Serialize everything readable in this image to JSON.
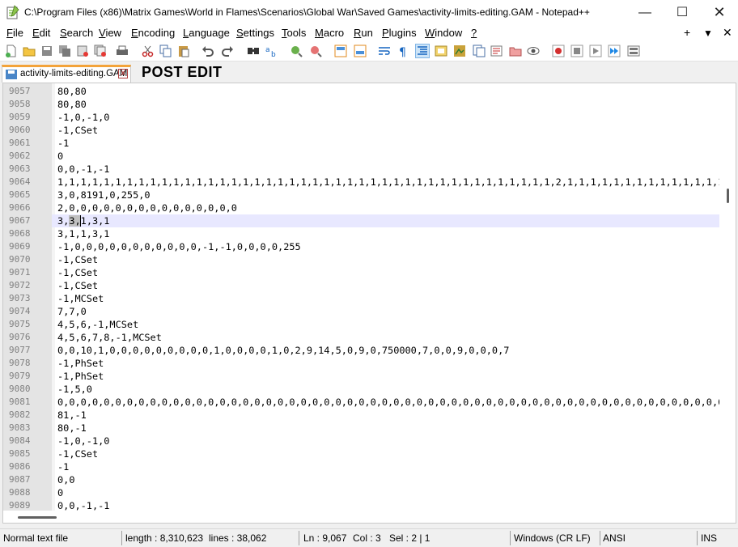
{
  "window": {
    "title": "C:\\Program Files (x86)\\Matrix Games\\World in Flames\\Scenarios\\Global War\\Saved Games\\activity-limits-editing.GAM - Notepad++",
    "controls": {
      "minimize": "—",
      "maximize": "☐",
      "close": "✕"
    }
  },
  "menu": {
    "items": [
      {
        "ul": "F",
        "rest": "ile"
      },
      {
        "ul": "E",
        "rest": "dit"
      },
      {
        "ul": "S",
        "rest": "earch"
      },
      {
        "ul": "V",
        "rest": "iew"
      },
      {
        "ul": "E",
        "rest": "ncoding"
      },
      {
        "ul": "L",
        "rest": "anguage"
      },
      {
        "ul": "S",
        "rest": "ettings"
      },
      {
        "ul": "T",
        "rest": "ools"
      },
      {
        "ul": "M",
        "rest": "acro"
      },
      {
        "ul": "R",
        "rest": "un"
      },
      {
        "ul": "P",
        "rest": "lugins"
      },
      {
        "ul": "W",
        "rest": "indow"
      },
      {
        "ul": "?",
        "rest": ""
      }
    ],
    "plus": "+",
    "dropdown": "▼",
    "close": "✕"
  },
  "toolbar": {
    "icons": [
      "new-file-icon",
      "open-file-icon",
      "save-icon",
      "save-all-icon",
      "close-icon",
      "close-all-icon",
      "print-icon",
      "cut-icon",
      "copy-icon",
      "paste-icon",
      "undo-icon",
      "redo-icon",
      "find-icon",
      "replace-icon",
      "zoom-in-icon",
      "zoom-out-icon",
      "sync-vertical-icon",
      "sync-horizontal-icon",
      "word-wrap-icon",
      "show-all-chars-icon",
      "indent-guide-icon",
      "udl-icon",
      "doc-map-icon",
      "function-list-icon",
      "folder-workspace-icon",
      "doc-list-icon",
      "monitoring-icon",
      "record-macro-icon",
      "stop-record-icon",
      "play-macro-icon",
      "run-macro-multiple-icon",
      "save-macro-icon"
    ]
  },
  "tab": {
    "label": "activity-limits-editing.GAM",
    "close": "x"
  },
  "overlay_label": "POST EDIT",
  "editor": {
    "current_line": "9067",
    "lines": [
      {
        "num": "9057",
        "text": "80,80"
      },
      {
        "num": "9058",
        "text": "80,80"
      },
      {
        "num": "9059",
        "text": "-1,0,-1,0"
      },
      {
        "num": "9060",
        "text": "-1,CSet"
      },
      {
        "num": "9061",
        "text": "-1"
      },
      {
        "num": "9062",
        "text": "0"
      },
      {
        "num": "9063",
        "text": "0,0,-1,-1"
      },
      {
        "num": "9064",
        "text": "1,1,1,1,1,1,1,1,1,1,1,1,1,1,1,1,1,1,1,1,1,1,1,1,1,1,1,1,1,1,1,1,1,1,1,1,1,1,1,1,1,1,1,2,1,1,1,1,1,1,1,1,1,1,1,1,1,1,1,1,1,1"
      },
      {
        "num": "9065",
        "text": "3,0,8191,0,255,0"
      },
      {
        "num": "9066",
        "text": "2,0,0,0,0,0,0,0,0,0,0,0,0,0,0,0"
      },
      {
        "num": "9067",
        "pre": "3,",
        "sel": "3,",
        "post": "1,3,1"
      },
      {
        "num": "9068",
        "text": "3,1,1,3,1"
      },
      {
        "num": "9069",
        "text": "-1,0,0,0,0,0,0,0,0,0,0,0,-1,-1,0,0,0,0,255"
      },
      {
        "num": "9070",
        "text": "-1,CSet"
      },
      {
        "num": "9071",
        "text": "-1,CSet"
      },
      {
        "num": "9072",
        "text": "-1,CSet"
      },
      {
        "num": "9073",
        "text": "-1,MCSet"
      },
      {
        "num": "9074",
        "text": "7,7,0"
      },
      {
        "num": "9075",
        "text": "4,5,6,-1,MCSet"
      },
      {
        "num": "9076",
        "text": "4,5,6,7,8,-1,MCSet"
      },
      {
        "num": "9077",
        "text": "0,0,10,1,0,0,0,0,0,0,0,0,0,1,0,0,0,0,1,0,2,9,14,5,0,9,0,750000,7,0,0,9,0,0,0,7"
      },
      {
        "num": "9078",
        "text": "-1,PhSet"
      },
      {
        "num": "9079",
        "text": "-1,PhSet"
      },
      {
        "num": "9080",
        "text": "-1,5,0"
      },
      {
        "num": "9081",
        "text": "0,0,0,0,0,0,0,0,0,0,0,0,0,0,0,0,0,0,0,0,0,0,0,0,0,0,0,0,0,0,0,0,0,0,0,0,0,0,0,0,0,0,0,0,0,0,0,0,0,0,0,0,0,0,0,0,0,0,0,0,0,0"
      },
      {
        "num": "9082",
        "text": "81,-1"
      },
      {
        "num": "9083",
        "text": "80,-1"
      },
      {
        "num": "9084",
        "text": "-1,0,-1,0"
      },
      {
        "num": "9085",
        "text": "-1,CSet"
      },
      {
        "num": "9086",
        "text": "-1"
      },
      {
        "num": "9087",
        "text": "0,0"
      },
      {
        "num": "9088",
        "text": "0"
      },
      {
        "num": "9089",
        "text": "0,0,-1,-1"
      }
    ]
  },
  "status": {
    "file_type": "Normal text file",
    "length": "length : 8,310,623",
    "lines": "lines : 38,062",
    "position": "Ln : 9,067",
    "col": "Col : 3",
    "sel": "Sel : 2 | 1",
    "eol": "Windows (CR LF)",
    "encoding": "ANSI",
    "mode": "INS"
  }
}
